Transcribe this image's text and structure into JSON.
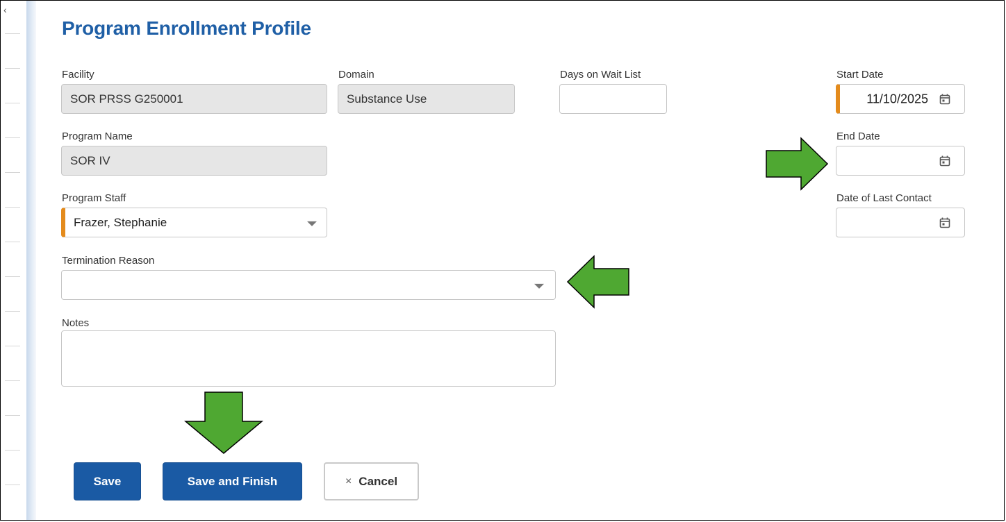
{
  "page": {
    "title": "Program Enrollment Profile"
  },
  "fields": {
    "facility": {
      "label": "Facility",
      "value": "SOR PRSS G250001"
    },
    "domain": {
      "label": "Domain",
      "value": "Substance Use"
    },
    "days_wait": {
      "label": "Days on Wait List",
      "value": ""
    },
    "start_date": {
      "label": "Start Date",
      "value": "11/10/2025"
    },
    "program_name": {
      "label": "Program Name",
      "value": "SOR IV"
    },
    "end_date": {
      "label": "End Date",
      "value": ""
    },
    "program_staff": {
      "label": "Program Staff",
      "value": "Frazer, Stephanie"
    },
    "last_contact": {
      "label": "Date of Last Contact",
      "value": ""
    },
    "termination_reason": {
      "label": "Termination Reason",
      "value": ""
    },
    "notes": {
      "label": "Notes",
      "value": ""
    }
  },
  "buttons": {
    "save": "Save",
    "save_finish": "Save and Finish",
    "cancel": "Cancel",
    "cancel_icon": "×"
  },
  "icons": {
    "calendar": "calendar-icon",
    "dropdown": "chevron-down-icon",
    "collapse": "chevron-left-icon",
    "annotation_arrow": "arrow-icon"
  },
  "colors": {
    "accent": "#1a5aa4",
    "title": "#1f5fa6",
    "required": "#e48b1c",
    "arrow_fill": "#4fa832",
    "readonly_bg": "#e6e6e6"
  }
}
